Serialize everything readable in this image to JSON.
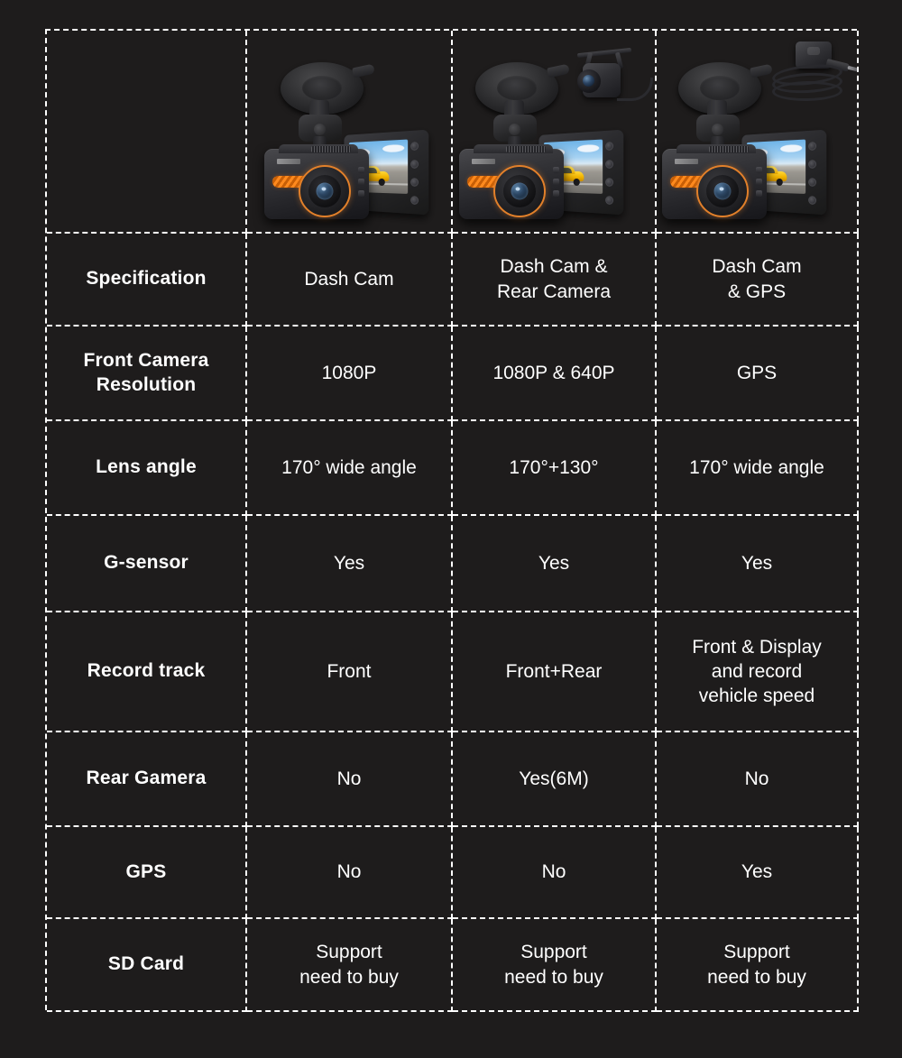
{
  "table": {
    "columns": [
      {
        "key": "spec",
        "header_label": "",
        "product": null
      },
      {
        "key": "col1",
        "header_label": "",
        "product": {
          "name": "dash-cam-front-only",
          "accessory": "none",
          "screen_scene": "yellow-sports-car-on-road",
          "accent_color": "#e2802a"
        }
      },
      {
        "key": "col2",
        "header_label": "",
        "product": {
          "name": "dash-cam-with-rear-camera",
          "accessory": "rear-camera",
          "screen_scene": "yellow-sports-car-on-road",
          "accent_color": "#e2802a"
        }
      },
      {
        "key": "col3",
        "header_label": "",
        "product": {
          "name": "dash-cam-with-gps",
          "accessory": "gps-module",
          "screen_scene": "yellow-sports-car-on-road",
          "accent_color": "#e2802a"
        }
      }
    ],
    "rows": [
      {
        "label": "Specification",
        "values": [
          "Dash Cam",
          "Dash Cam &\nRear Camera",
          "Dash Cam\n& GPS"
        ]
      },
      {
        "label": "Front Camera\nResolution",
        "values": [
          "1080P",
          "1080P & 640P",
          "GPS"
        ]
      },
      {
        "label": "Lens angle",
        "values": [
          "170° wide angle",
          "170°+130°",
          "170° wide angle"
        ]
      },
      {
        "label": "G-sensor",
        "values": [
          "Yes",
          "Yes",
          "Yes"
        ]
      },
      {
        "label": "Record track",
        "values": [
          "Front",
          "Front+Rear",
          "Front & Display\nand record\nvehicle speed"
        ]
      },
      {
        "label": "Rear Gamera",
        "values": [
          "No",
          "Yes(6M)",
          "No"
        ]
      },
      {
        "label": "GPS",
        "values": [
          "No",
          "No",
          "Yes"
        ]
      },
      {
        "label": "SD Card",
        "values": [
          "Support\nneed to buy",
          "Support\nneed to buy",
          "Support\nneed to buy"
        ]
      }
    ]
  },
  "style": {
    "background_color": "#1e1c1c",
    "border_color": "#ffffff",
    "text_color": "#ffffff",
    "accent_color": "#e2802a"
  }
}
